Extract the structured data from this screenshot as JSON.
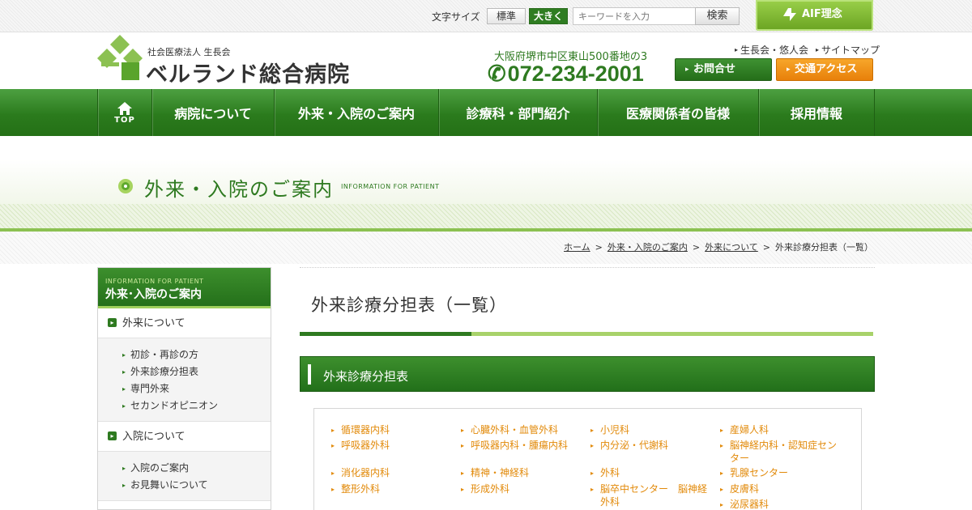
{
  "utility": {
    "font_size_label": "文字サイズ",
    "font_standard": "標準",
    "font_large": "大きく",
    "search_placeholder": "キーワードを入力",
    "search_button": "検索",
    "aif_button": "AIF理念"
  },
  "header": {
    "corp_name": "社会医療法人 生長会",
    "hospital_name": "ベルランド総合病院",
    "address": "大阪府堺市中区東山500番地の3",
    "phone": "072-234-2001",
    "links": [
      "生長会・悠人会",
      "サイトマップ"
    ],
    "contact_button": "お問合せ",
    "access_button": "交通アクセス"
  },
  "nav": {
    "top_label": "TOP",
    "items": [
      "病院について",
      "外来・入院のご案内",
      "診療科・部門紹介",
      "医療関係者の皆様",
      "採用情報"
    ]
  },
  "page_title": {
    "jp": "外来・入院のご案内",
    "en": "INFORMATION FOR PATIENT"
  },
  "breadcrumb": {
    "items": [
      "ホーム",
      "外来・入院のご案内",
      "外来について"
    ],
    "current": "外来診療分担表（一覧）",
    "sep": ">"
  },
  "sidebar": {
    "head_en": "INFORMATION FOR PATIENT",
    "head_jp": "外来･入院のご案内",
    "sections": [
      {
        "label": "外来について",
        "items": [
          "初診・再診の方",
          "外来診療分担表",
          "専門外来",
          "セカンドオピニオン"
        ]
      },
      {
        "label": "入院について",
        "items": [
          "入院のご案内",
          "お見舞いについて"
        ]
      }
    ]
  },
  "main": {
    "title": "外来診療分担表（一覧）",
    "section_title": "外来診療分担表",
    "departments": [
      "循環器内科",
      "心臓外科・血管外科",
      "小児科",
      "産婦人科",
      "呼吸器外科",
      "呼吸器内科・腫瘍内科",
      "内分泌・代謝科",
      "脳神経内科・認知症センター",
      "消化器内科",
      "精神・神経科",
      "外科",
      "乳腺センター",
      "整形外科",
      "形成外科",
      "脳卒中センター　脳神経外科",
      "皮膚科",
      "泌尿器科"
    ]
  },
  "colors": {
    "brand_green": "#2e7a20",
    "accent_lime": "#8cc152",
    "link_orange": "#e28a0a",
    "access_orange": "#f39c1b"
  }
}
